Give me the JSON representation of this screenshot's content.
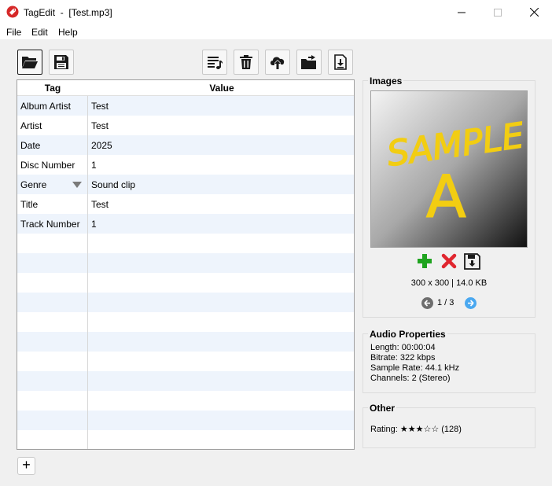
{
  "window": {
    "app_name": "TagEdit",
    "separator": "-",
    "file_name": "[Test.mp3]"
  },
  "menu": [
    "File",
    "Edit",
    "Help"
  ],
  "table": {
    "headers": {
      "tag": "Tag",
      "value": "Value"
    },
    "rows": [
      {
        "tag": "Album Artist",
        "value": "Test"
      },
      {
        "tag": "Artist",
        "value": "Test"
      },
      {
        "tag": "Date",
        "value": "2025"
      },
      {
        "tag": "Disc Number",
        "value": "1"
      },
      {
        "tag": "Genre",
        "value": "Sound clip"
      },
      {
        "tag": "Title",
        "value": "Test"
      },
      {
        "tag": "Track Number",
        "value": "1"
      }
    ]
  },
  "add_row_label": "+",
  "images": {
    "title": "Images",
    "cover_text_line1": "SAMPLE",
    "cover_text_line2": "A",
    "info": "300 x 300 | 14.0 KB",
    "pager": "1 / 3"
  },
  "audio": {
    "title": "Audio Properties",
    "length": "Length: 00:00:04",
    "bitrate": "Bitrate: 322 kbps",
    "sample_rate": "Sample Rate: 44.1 kHz",
    "channels": "Channels: 2 (Stereo)"
  },
  "other": {
    "title": "Other",
    "rating": "Rating: ★★★☆☆ (128)"
  },
  "colors": {
    "accent": "#0067c0",
    "add": "#1fa31f",
    "remove": "#e0262f",
    "app_icon": "#d62828",
    "row_alt": "#eef4fc",
    "next": "#4aa8f0",
    "prev": "#6d6d6d"
  },
  "icons": {
    "open": "folder-open-icon",
    "save": "save-icon",
    "tags": "tags-list-icon",
    "delete": "trash-icon",
    "upload": "cloud-upload-icon",
    "export": "folder-export-icon",
    "download": "file-download-icon"
  }
}
